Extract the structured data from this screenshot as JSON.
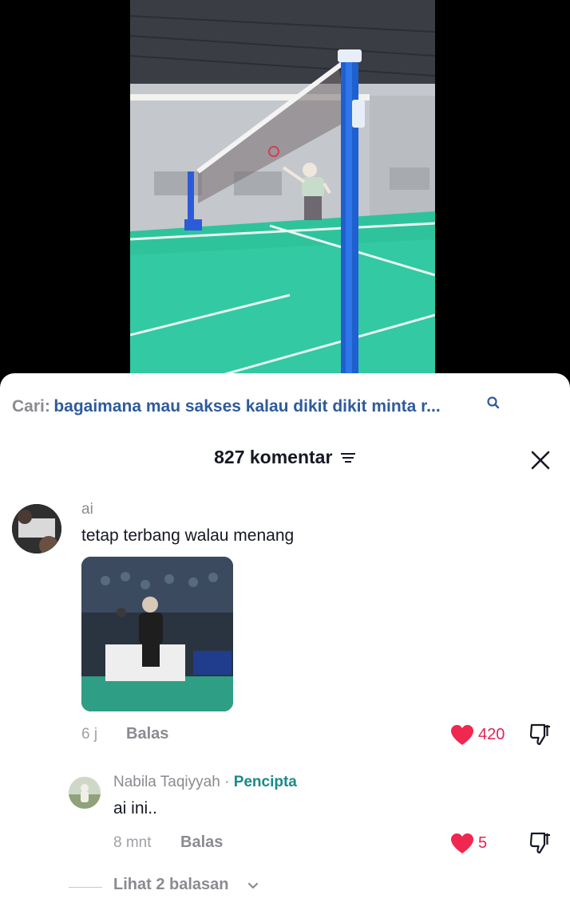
{
  "search": {
    "prefix": "Cari:",
    "query": "bagaimana mau sakses kalau dikit dikit minta r..."
  },
  "header": {
    "count_title": "827 komentar"
  },
  "comments": [
    {
      "username": "ai",
      "text": "tetap terbang walau menang",
      "time": "6 j",
      "reply_label": "Balas",
      "likes": "420"
    }
  ],
  "reply": {
    "username": "Nabila Taqiyyah",
    "separator": " · ",
    "tag": "Pencipta",
    "text": "ai ini..",
    "time": "8 mnt",
    "reply_label": "Balas",
    "likes": "5"
  },
  "view_replies": {
    "label": "Lihat 2 balasan"
  },
  "colors": {
    "accent_like": "#e1245a",
    "search_query": "#2e5b9a",
    "creator_tag": "#1a8a8a"
  },
  "icons": [
    "search-icon",
    "filter-icon",
    "close-icon",
    "heart-icon",
    "dislike-icon",
    "chevron-down-icon"
  ]
}
